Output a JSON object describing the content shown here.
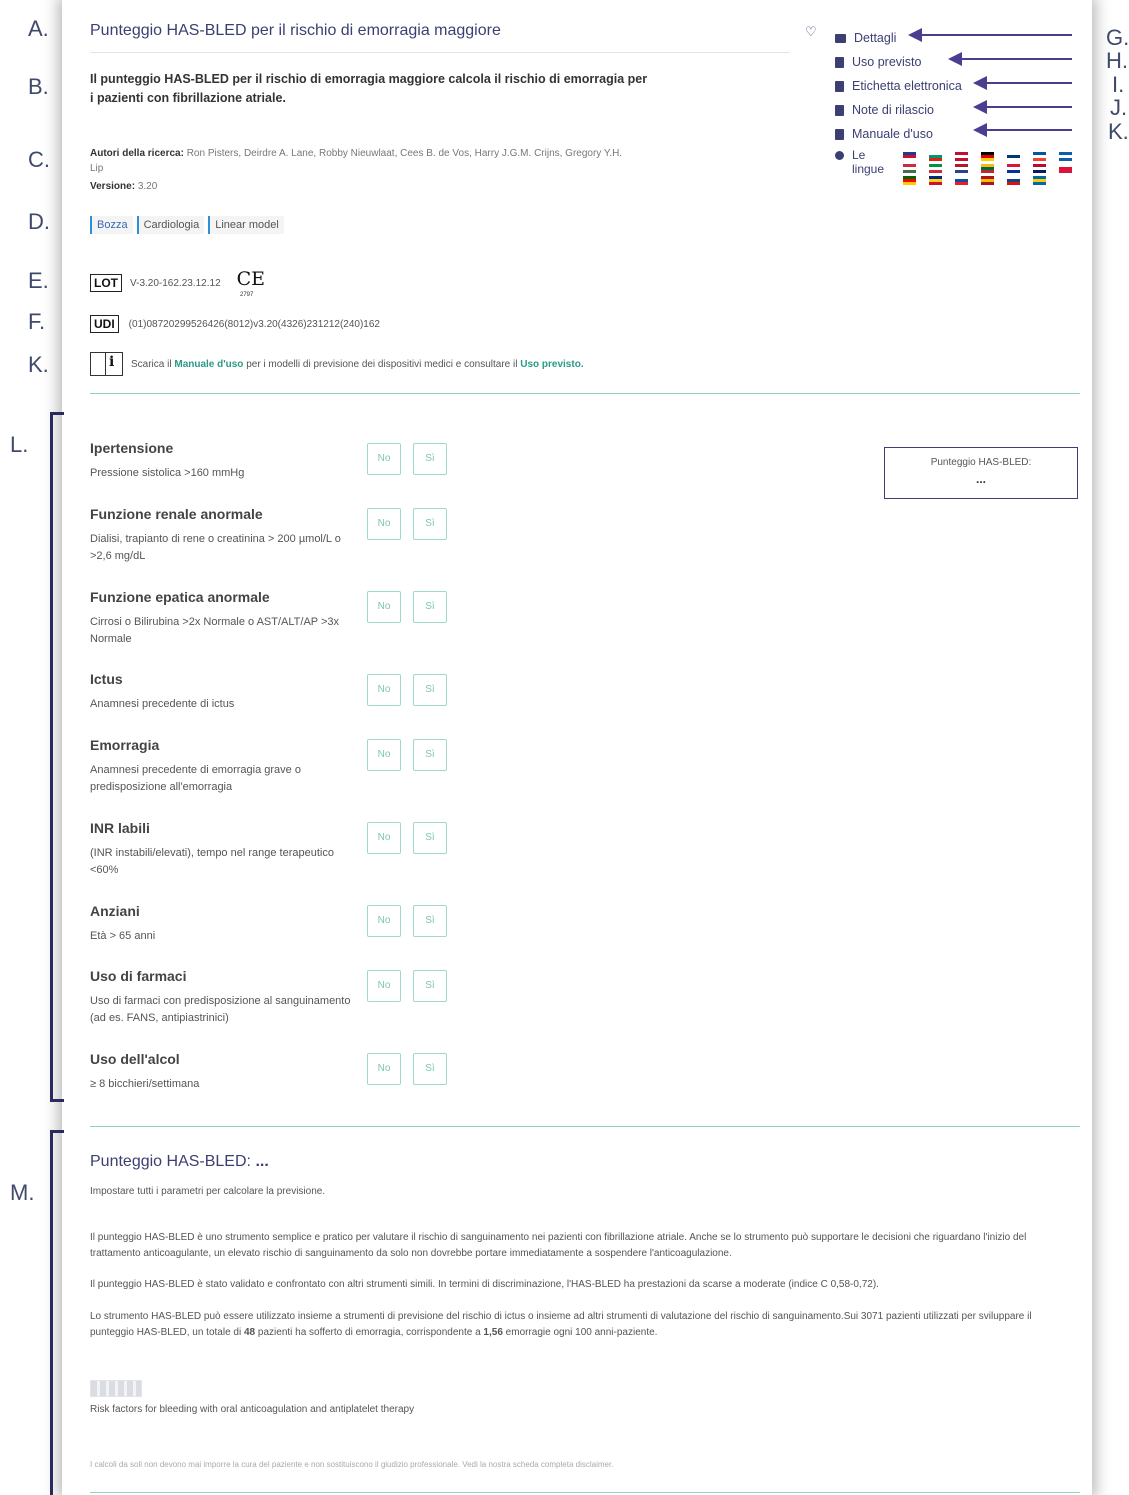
{
  "annotations": {
    "left": [
      "A.",
      "B.",
      "C.",
      "D.",
      "E.",
      "F.",
      "K.",
      "L.",
      "M."
    ],
    "right": [
      "G.",
      "H.",
      "I.",
      "J.",
      "K."
    ]
  },
  "header": {
    "title": "Punteggio HAS-BLED per il rischio di emorragia maggiore",
    "description": "Il punteggio HAS-BLED per il rischio di emorragia maggiore calcola il rischio di emorragia per i pazienti con fibrillazione atriale.",
    "authors_label": "Autori della ricerca:",
    "authors": "Ron Pisters, Deirdre A. Lane, Robby Nieuwlaat, Cees B. de Vos, Harry J.G.M. Crijns, Gregory Y.H. Lip",
    "version_label": "Versione:",
    "version": "3.20",
    "tags": [
      "Bozza",
      "Cardiologia",
      "Linear model"
    ],
    "lot_label": "LOT",
    "lot": "V-3.20-162.23.12.12",
    "ce_mark": "CE",
    "ce_number": "2797",
    "udi_label": "UDI",
    "udi": "(01)08720299526426(8012)v3.20(4326)231212(240)162",
    "manual_prefix": "Scarica il",
    "manual_link": "Manuale d'uso",
    "manual_middle": "per i modelli di previsione dei dispositivi medici e consultare il",
    "intended_link": "Uso previsto",
    "manual_suffix": "."
  },
  "nav": {
    "items": [
      "Dettagli",
      "Uso previsto",
      "Etichetta elettronica",
      "Note di rilascio",
      "Manuale d'uso"
    ],
    "lang_label_1": "Le",
    "lang_label_2": "lingue",
    "flags": [
      [
        "#1f3a93",
        "#c8102e",
        "#ffffff"
      ],
      [
        "#ffffff",
        "#00966e",
        "#d62612"
      ],
      [
        "#c60c30",
        "#ffffff",
        "#c60c30"
      ],
      [
        "#000000",
        "#dd0000",
        "#ffce00"
      ],
      [
        "#ffffff",
        "#003580",
        "#ffffff"
      ],
      [
        "#0055a4",
        "#ffffff",
        "#ef4135"
      ],
      [
        "#0d5eaf",
        "#ffffff",
        "#0d5eaf"
      ],
      [
        "#cd2a3e",
        "#ffffff",
        "#436f4d"
      ],
      [
        "#009246",
        "#ffffff",
        "#ce2b37"
      ],
      [
        "#ae1c28",
        "#ffffff",
        "#21468b"
      ],
      [
        "#fdb913",
        "#006a44",
        "#c1272d"
      ],
      [
        "#dc143c",
        "#ffffff",
        "#0033a0"
      ],
      [
        "#ba0c2f",
        "#ffffff",
        "#00205b"
      ],
      [
        "#ffffff",
        "#dc143c",
        "#dc143c"
      ],
      [
        "#006600",
        "#ff0000",
        "#ffcc00"
      ],
      [
        "#002b7f",
        "#fcd116",
        "#ce1126"
      ],
      [
        "#ffffff",
        "#0b4ea2",
        "#ee1c25"
      ],
      [
        "#aa151b",
        "#f1bf00",
        "#aa151b"
      ],
      [
        "#ffffff",
        "#11457e",
        "#d7141a"
      ],
      [
        "#006aa7",
        "#fecc00",
        "#006aa7"
      ]
    ]
  },
  "questions": [
    {
      "title": "Ipertensione",
      "subtitle": "Pressione sistolica >160 mmHg"
    },
    {
      "title": "Funzione renale anormale",
      "subtitle": "Dialisi, trapianto di rene o creatinina > 200 µmol/L o >2,6 mg/dL"
    },
    {
      "title": "Funzione epatica anormale",
      "subtitle": "Cirrosi o Bilirubina >2x Normale o AST/ALT/AP >3x Normale"
    },
    {
      "title": "Ictus",
      "subtitle": "Anamnesi precedente di ictus"
    },
    {
      "title": "Emorragia",
      "subtitle": "Anamnesi precedente di emorragia grave o predisposizione all'emorragia"
    },
    {
      "title": "INR labili",
      "subtitle": "(INR instabili/elevati), tempo nel range terapeutico <60%"
    },
    {
      "title": "Anziani",
      "subtitle": "Età > 65 anni"
    },
    {
      "title": "Uso di farmaci",
      "subtitle": "Uso di farmaci con predisposizione al sanguinamento (ad es. FANS, antipiastrinici)"
    },
    {
      "title": "Uso dell'alcol",
      "subtitle": "≥ 8 bicchieri/settimana"
    }
  ],
  "buttons": {
    "no": "No",
    "yes": "Sì"
  },
  "scorebox": {
    "label": "Punteggio HAS-BLED:",
    "value": "..."
  },
  "result": {
    "title": "Punteggio HAS-BLED:",
    "value": "...",
    "subtitle": "Impostare tutti i parametri per calcolare la previsione.",
    "p1": "Il punteggio HAS-BLED è uno strumento semplice e pratico per valutare il rischio di sanguinamento nei pazienti con fibrillazione atriale. Anche se lo strumento può supportare le decisioni che riguardano l'inizio del trattamento anticoagulante, un elevato rischio di sanguinamento da solo non dovrebbe portare immediatamente a sospendere l'anticoagulazione.",
    "p2": "Il punteggio HAS-BLED è stato validato e confrontato con altri strumenti simili. In termini di discriminazione, l'HAS-BLED ha prestazioni da scarse a moderate (indice C 0,58-0,72).",
    "p3_a": "Lo strumento HAS-BLED può essere utilizzato insieme a strumenti di previsione del rischio di ictus o insieme ad altri strumenti di valutazione del rischio di sanguinamento.Sui 3071 pazienti utilizzati per sviluppare il punteggio HAS-BLED, un totale di",
    "p3_b": "48",
    "p3_c": "pazienti ha sofferto di emorragia, corrispondente a",
    "p3_d": "1,56",
    "p3_e": "emorragie ogni 100 anni-paziente.",
    "caption": "Risk factors for bleeding with oral anticoagulation and antiplatelet therapy",
    "disclaimer": "I calcoli da soli non devono mai imporre la cura del paziente e non sostituiscono il giudizio professionale. Vedi la nostra scheda completa disclaimer."
  }
}
